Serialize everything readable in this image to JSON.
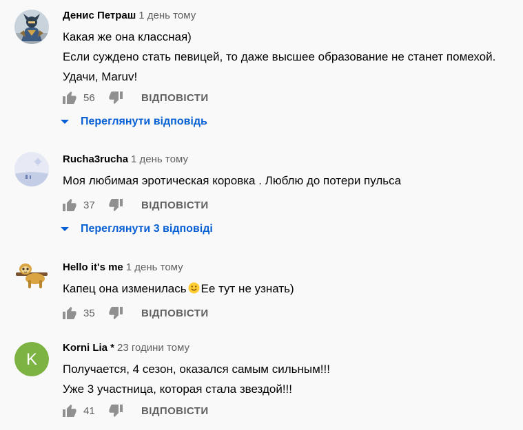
{
  "comments": [
    {
      "author": "Денис Петраш",
      "time": "1 день тому",
      "lines": [
        "Какая же она классная)",
        "Если суждено стать певицей, то даже высшее образование не станет помехой.",
        "Удачи, Maruv!"
      ],
      "likes": "56",
      "reply_label": "ВІДПОВІСТИ",
      "view_replies": "Переглянути відповідь",
      "avatar_icon": "warrior-avatar"
    },
    {
      "author": "Rucha3rucha",
      "time": "1 день тому",
      "lines": [
        "Моя любимая эротическая коровка . Люблю до потери пульса"
      ],
      "likes": "37",
      "reply_label": "ВІДПОВІСТИ",
      "view_replies": "Переглянути 3 відповіді",
      "avatar_icon": "landscape-avatar"
    },
    {
      "author": "Hello it's me",
      "time": "1 день тому",
      "text_before_emoji": "Капец она изменилась",
      "emoji": "smiling-face-emoji",
      "text_after_emoji": "Ее тут не узнать)",
      "likes": "35",
      "reply_label": "ВІДПОВІСТИ",
      "avatar_icon": "sloth-avatar"
    },
    {
      "author": "Korni Lia *",
      "time": "23 години тому",
      "avatar_letter": "K",
      "avatar_color": "#7cb342",
      "lines": [
        "Получается, 4 сезон, оказался самым сильным!!!",
        "Уже 3 участница, которая стала звездой!!!"
      ],
      "likes": "41",
      "reply_label": "ВІДПОВІСТИ"
    }
  ],
  "colors": {
    "background": "#f9f9f9",
    "link_blue": "#065fd4",
    "secondary_text": "#606060",
    "icon_gray": "#909090"
  }
}
